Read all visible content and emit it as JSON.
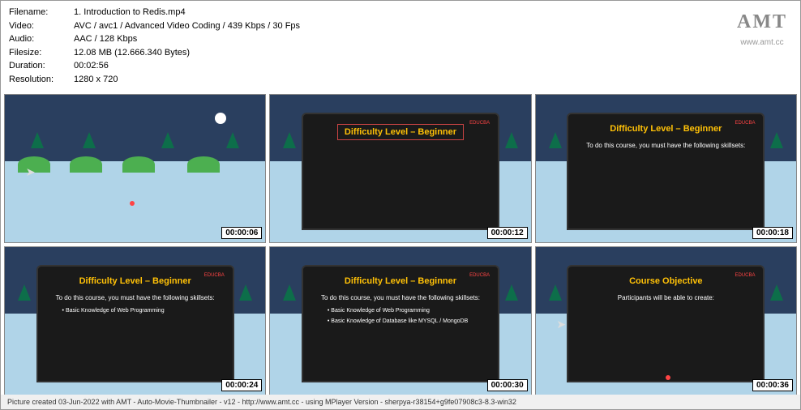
{
  "header": {
    "filename_label": "Filename:",
    "filename_value": "1. Introduction to Redis.mp4",
    "video_label": "Video:",
    "video_value": "AVC / avc1 / Advanced Video Coding / 439 Kbps / 30 Fps",
    "audio_label": "Audio:",
    "audio_value": "AAC / 128 Kbps",
    "filesize_label": "Filesize:",
    "filesize_value": "12.08 MB (12.666.340 Bytes)",
    "duration_label": "Duration:",
    "duration_value": "00:02:56",
    "resolution_label": "Resolution:",
    "resolution_value": "1280 x 720"
  },
  "logo": {
    "text": "AMT",
    "url": "www.amt.cc"
  },
  "thumbs": [
    {
      "timestamp": "00:00:06"
    },
    {
      "timestamp": "00:00:12",
      "title": "Difficulty Level – Beginner"
    },
    {
      "timestamp": "00:00:18",
      "title": "Difficulty Level – Beginner",
      "text": "To do this course, you must have the following skillsets:"
    },
    {
      "timestamp": "00:00:24",
      "title": "Difficulty Level – Beginner",
      "text": "To do this course, you must have the following skillsets:",
      "bullet1": "•   Basic Knowledge of Web Programming"
    },
    {
      "timestamp": "00:00:30",
      "title": "Difficulty Level – Beginner",
      "text": "To do this course, you must have the following skillsets:",
      "bullet1": "•   Basic Knowledge of Web Programming",
      "bullet2": "•   Basic Knowledge of Database like MYSQL / MongoDB"
    },
    {
      "timestamp": "00:00:36",
      "title": "Course Objective",
      "text": "Participants will be able to create:"
    }
  ],
  "brand": "EDUCBA",
  "footer": "Picture created 03-Jun-2022 with AMT - Auto-Movie-Thumbnailer - v12 - http://www.amt.cc - using MPlayer Version - sherpya-r38154+g9fe07908c3-8.3-win32"
}
